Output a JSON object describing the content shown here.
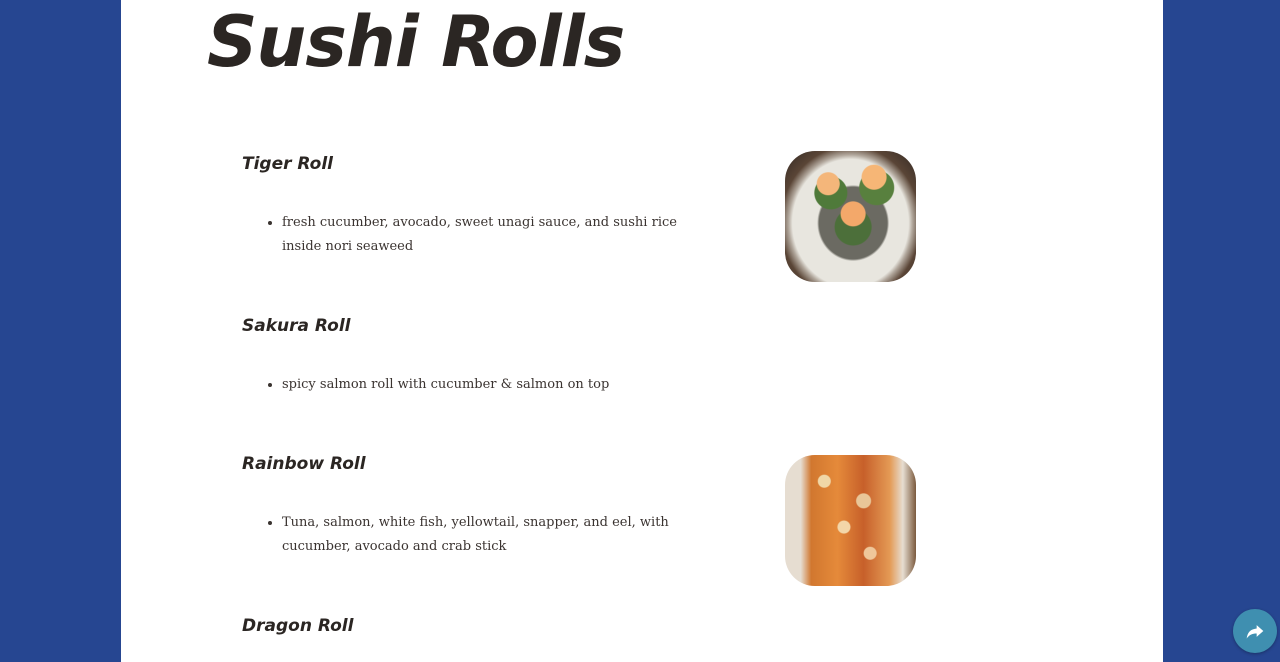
{
  "page": {
    "title": "Sushi Rolls"
  },
  "rolls": [
    {
      "name": "Tiger Roll",
      "description": "fresh cucumber, avocado, sweet unagi sauce, and sushi rice inside nori seaweed"
    },
    {
      "name": "Sakura Roll",
      "description": "spicy salmon roll with cucumber & salmon on top"
    },
    {
      "name": "Rainbow Roll",
      "description": "Tuna, salmon, white fish, yellowtail, snapper, and eel, with cucumber, avocado and crab stick"
    },
    {
      "name": "Dragon Roll",
      "description": ""
    }
  ],
  "share": {
    "icon": "share-arrow-icon"
  },
  "colors": {
    "background": "#264691",
    "text": "#2b2623",
    "share_button": "#3f8fb0"
  }
}
